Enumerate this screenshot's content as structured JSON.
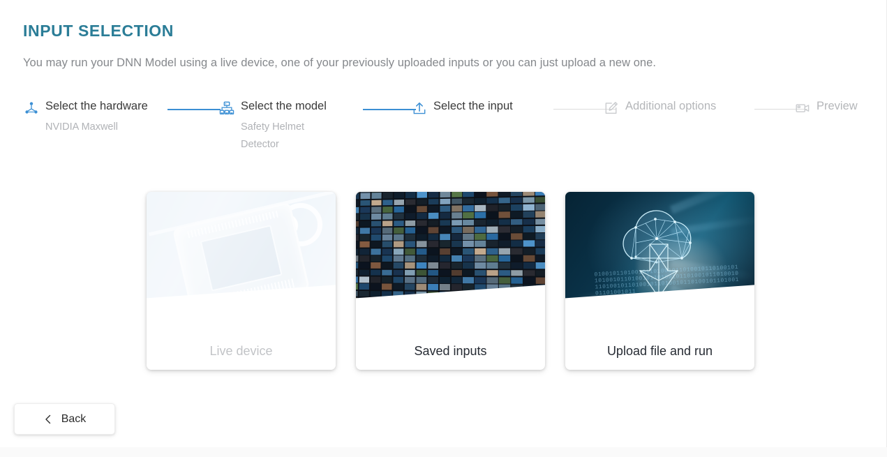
{
  "page": {
    "title": "INPUT SELECTION",
    "subtitle": "You may run your DNN Model using a live device, one of your previously uploaded inputs or you can just upload a new one.",
    "accent_color": "#2b7d97",
    "step_active_color": "#3b8fd4",
    "step_inactive_color": "#b4b6b9"
  },
  "stepper": {
    "steps": [
      {
        "label": "Select the hardware",
        "sub": "NVIDIA Maxwell",
        "icon": "hardware-node-icon",
        "state": "completed"
      },
      {
        "label": "Select the model",
        "sub": "Safety Helmet Detector",
        "icon": "sitemap-icon",
        "state": "completed"
      },
      {
        "label": "Select the input",
        "sub": "",
        "icon": "upload-icon",
        "state": "current"
      },
      {
        "label": "Additional options",
        "sub": "",
        "icon": "edit-pencil-icon",
        "state": "disabled"
      },
      {
        "label": "Preview",
        "sub": "",
        "icon": "video-camera-icon",
        "state": "disabled"
      }
    ]
  },
  "cards": [
    {
      "label": "Live device",
      "art": "chip-sensor-photo",
      "state": "disabled"
    },
    {
      "label": "Saved inputs",
      "art": "video-wall-photo",
      "state": "enabled"
    },
    {
      "label": "Upload file and run",
      "art": "cloud-network-photo",
      "state": "enabled"
    }
  ],
  "footer": {
    "back_label": "Back",
    "back_icon": "chevron-left-icon"
  }
}
